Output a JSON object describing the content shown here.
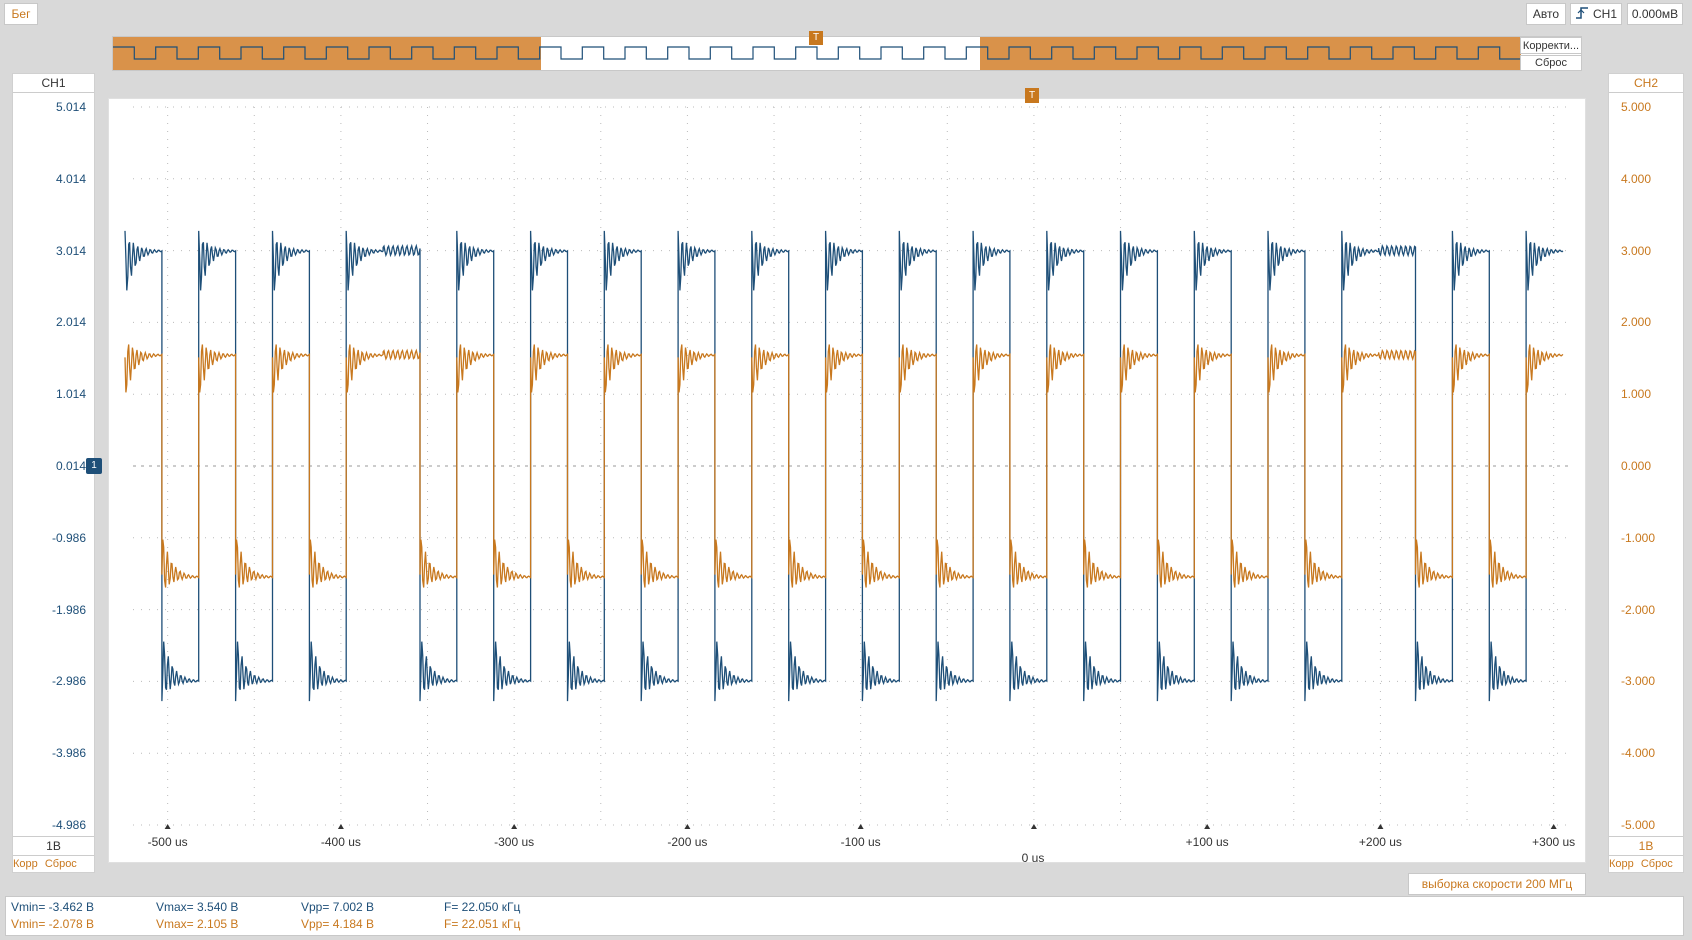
{
  "status": {
    "run_label": "Бег"
  },
  "top_controls": {
    "mode": "Авто",
    "channel": "CH1",
    "level": "0.000мВ"
  },
  "overview": {
    "zoom_label": "Корректи...",
    "reset_label": "Сброс",
    "trigger_marker": "T"
  },
  "trigger_marker": "T",
  "ch1": {
    "name": "CH1",
    "scale": "1В",
    "korr": "Корр",
    "reset": "Сброс",
    "color": "#1e4f78",
    "ground_marker": "1"
  },
  "ch2": {
    "name": "CH2",
    "scale": "1В",
    "korr": "Корр",
    "reset": "Сброс",
    "color": "#c8781e"
  },
  "sample_rate": "выборка скорости 200 МГц",
  "measurements": [
    {
      "vmin": "Vmin= -3.462 В",
      "vmax": "Vmax= 3.540 В",
      "vpp": "Vpp= 7.002 В",
      "freq": "F= 22.050 кГц"
    },
    {
      "vmin": "Vmin= -2.078 В",
      "vmax": "Vmax= 2.105 В",
      "vpp": "Vpp= 4.184 В",
      "freq": "F= 22.051 кГц"
    }
  ],
  "axes": {
    "left_ticks": [
      "5.014",
      "4.014",
      "3.014",
      "2.014",
      "1.014",
      "0.014",
      "-0.986",
      "-1.986",
      "-2.986",
      "-3.986",
      "-4.986"
    ],
    "right_ticks": [
      "5.000",
      "4.000",
      "3.000",
      "2.000",
      "1.000",
      "0.000",
      "-1.000",
      "-2.000",
      "-3.000",
      "-4.000",
      "-5.000"
    ],
    "x_ticks": [
      "-500 us",
      "-400 us",
      "-300 us",
      "-200 us",
      "-100 us",
      "",
      "+100 us",
      "+200 us",
      "+300 us"
    ],
    "x_center_label": "0 us"
  },
  "chart_data": {
    "type": "line",
    "xlabel": "",
    "ylabel": "",
    "xlim": [
      -520,
      310
    ],
    "ylim": [
      -5,
      5
    ],
    "x_unit": "us",
    "series": [
      {
        "name": "CH1",
        "color": "#1e4f78",
        "vmin": -3.462,
        "vmax": 3.54,
        "vpp": 7.002,
        "freq_khz": 22.05
      },
      {
        "name": "CH2",
        "color": "#c8781e",
        "vmin": -2.078,
        "vmax": 2.105,
        "vpp": 4.184,
        "freq_khz": 22.051
      }
    ],
    "bit_pattern": [
      1,
      0,
      1,
      0,
      1,
      0,
      1,
      1,
      0,
      1,
      0,
      1,
      0,
      1,
      0,
      1,
      0,
      1,
      0,
      1,
      0,
      1,
      0,
      1,
      0,
      1,
      0,
      1,
      0,
      1,
      0,
      1,
      0,
      1,
      1,
      0,
      1,
      0,
      1
    ]
  }
}
